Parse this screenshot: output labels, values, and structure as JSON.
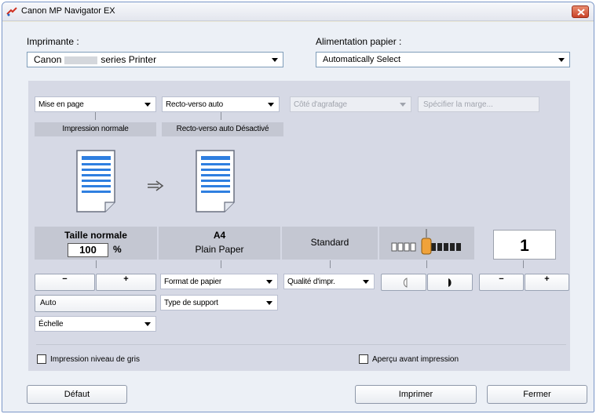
{
  "window": {
    "title": "Canon MP Navigator EX"
  },
  "printer": {
    "label": "Imprimante :",
    "value_prefix": "Canon",
    "value_suffix": "series Printer"
  },
  "paper_source": {
    "label": "Alimentation papier :",
    "value": "Automatically Select"
  },
  "layout": {
    "dropdown": "Mise en page",
    "status": "Impression normale"
  },
  "duplex": {
    "dropdown": "Recto-verso auto",
    "status": "Recto-verso auto Désactivé"
  },
  "staple": {
    "dropdown": "Côté d'agrafage"
  },
  "margin_button": "Spécifier la marge...",
  "size": {
    "title": "Taille normale",
    "scale_value": "100",
    "scale_unit": "%",
    "minus": "−",
    "plus": "+",
    "auto_button": "Auto",
    "scale_dropdown": "Échelle"
  },
  "paper": {
    "size": "A4",
    "type": "Plain Paper",
    "size_dropdown": "Format de papier",
    "type_dropdown": "Type de support"
  },
  "quality": {
    "value": "Standard",
    "dropdown": "Qualité d'impr."
  },
  "density": {
    "level": 0.5
  },
  "copies": {
    "value": "1",
    "minus": "−",
    "plus": "+"
  },
  "options": {
    "grayscale": {
      "label": "Impression niveau de gris",
      "checked": false
    },
    "preview": {
      "label": "Aperçu avant impression",
      "checked": false
    }
  },
  "buttons": {
    "default": "Défaut",
    "print": "Imprimer",
    "close": "Fermer"
  },
  "colors": {
    "panel": "#d6d9e5",
    "status_box": "#c4c7d2",
    "accent_handle": "#f0a23a",
    "doc_lines": "#2f7fe0"
  }
}
